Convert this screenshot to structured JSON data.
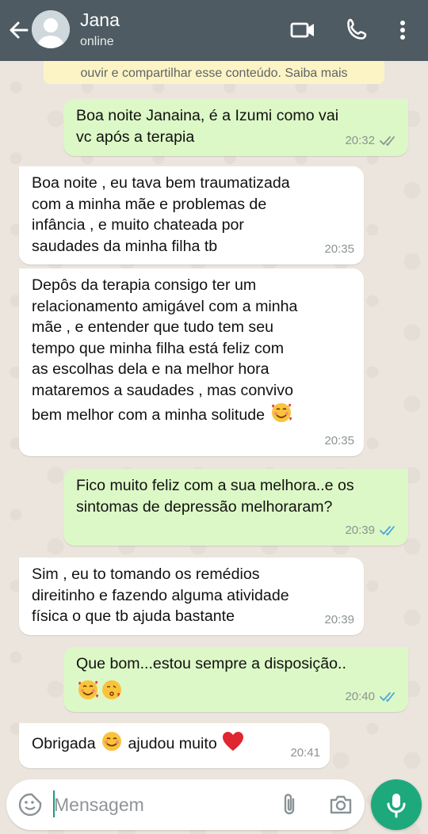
{
  "header": {
    "contact_name": "Jana",
    "status": "online",
    "icons": [
      "back-arrow-icon",
      "avatar-placeholder-icon",
      "video-call-icon",
      "phone-call-icon",
      "more-options-icon"
    ],
    "bar_color": "#4e5b62"
  },
  "notice": {
    "text": "ouvir e compartilhar esse conteúdo. Saiba mais"
  },
  "messages": [
    {
      "direction": "out",
      "text": "Boa noite Janaina, é a Izumi como vai\nvc após a terapia",
      "time": "20:32",
      "ticks": "read-gray"
    },
    {
      "direction": "in",
      "text": "Boa noite , eu tava bem traumatizada\ncom a minha mãe e problemas de\ninfância , e muito chateada por\nsaudades da minha filha tb",
      "time": "20:35"
    },
    {
      "direction": "in",
      "text": "Depôs da terapia consigo ter um\nrelacionamento amigável com a minha\nmãe , e entender que tudo tem seu\ntempo que minha filha está feliz com\nas escolhas dela e na melhor hora\nmataremos a saudades , mas convivo\nbem melhor com a minha solitude",
      "emoji": "smiling-face-with-hearts-emoji",
      "time": "20:35"
    },
    {
      "direction": "out",
      "text": "Fico muito feliz com a sua melhora..e os\nsintomas de depressão melhoraram?",
      "time": "20:39",
      "ticks": "read-blue"
    },
    {
      "direction": "in",
      "text": "Sim , eu to tomando os remédios\ndireitinho e fazendo alguma atividade\nfísica o que tb ajuda bastante",
      "time": "20:39"
    },
    {
      "direction": "out",
      "text": "Que bom...estou sempre a disposição..",
      "emoji": "smiling-face-with-hearts-emoji, face-blowing-kiss-emoji",
      "time": "20:40",
      "ticks": "read-blue"
    },
    {
      "direction": "in",
      "text_before": "Obrigada",
      "text_after": "ajudou muito",
      "emoji": "smiling-face-emoji, red-heart-emoji",
      "time": "20:41"
    }
  ],
  "input": {
    "placeholder": "Mensagem",
    "icons": [
      "emoji-sticker-icon",
      "attach-paperclip-icon",
      "camera-icon",
      "mic-icon"
    ]
  },
  "colors": {
    "outgoing_bubble": "#dcf8c6",
    "incoming_bubble": "#ffffff",
    "read_ticks": "#4fa3d9",
    "mic_button": "#1ea97c"
  }
}
